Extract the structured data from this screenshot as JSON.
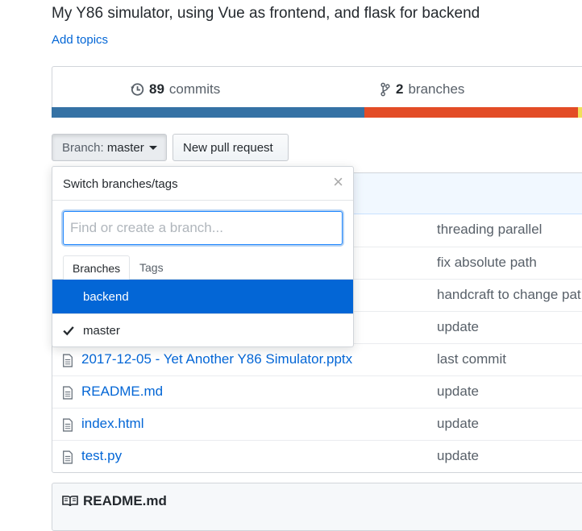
{
  "repo": {
    "description": "My Y86 simulator, using Vue as frontend, and flask for backend",
    "add_topics": "Add topics"
  },
  "summary": {
    "commits_count": "89",
    "commits_label": "commits",
    "branches_count": "2",
    "branches_label": "branches"
  },
  "language_bar": [
    {
      "color": "#3572A5",
      "share": 0.57
    },
    {
      "color": "#e34c26",
      "share": 0.39
    },
    {
      "color": "#f1e05a",
      "share": 0.04
    }
  ],
  "toolbar": {
    "branch_prefix": "Branch:",
    "branch_name": "master",
    "new_pr": "New pull request"
  },
  "branch_dropdown": {
    "title": "Switch branches/tags",
    "close": "×",
    "filter_placeholder": "Find or create a branch...",
    "filter_value": "",
    "tabs": [
      "Branches",
      "Tags"
    ],
    "items": [
      {
        "name": "backend",
        "highlighted": true,
        "checked": false
      },
      {
        "name": "master",
        "highlighted": false,
        "checked": true
      }
    ]
  },
  "files": [
    {
      "name": "",
      "message": "threading parallel"
    },
    {
      "name": "",
      "message": "fix absolute path"
    },
    {
      "name": "",
      "message": "handcraft to change pat"
    },
    {
      "name": "",
      "message": "update"
    },
    {
      "name": "2017-12-05 - Yet Another Y86 Simulator.pptx",
      "message": "last commit"
    },
    {
      "name": "README.md",
      "message": "update"
    },
    {
      "name": "index.html",
      "message": "update"
    },
    {
      "name": "test.py",
      "message": "update"
    }
  ],
  "readme": {
    "title": "README.md"
  }
}
